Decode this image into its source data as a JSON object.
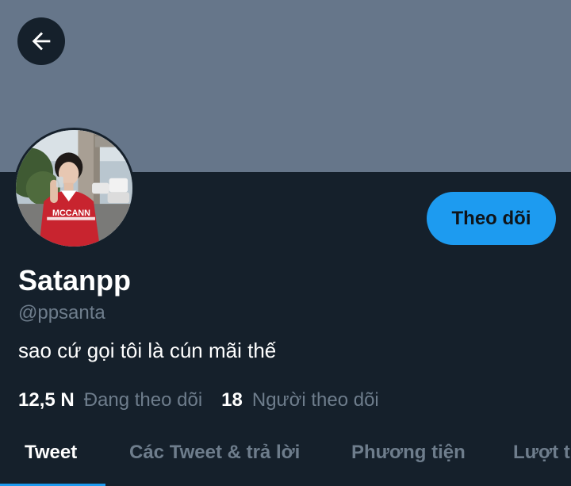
{
  "profile": {
    "display_name": "Satanpp",
    "handle": "@ppsanta",
    "bio": "sao cứ gọi tôi là cún mãi thế",
    "follow_label": "Theo dõi",
    "banner_color": "#66768a",
    "avatar_jersey_text": "MCCANN"
  },
  "stats": {
    "following_count": "12,5 N",
    "following_label": "Đang theo dõi",
    "followers_count": "18",
    "followers_label": "Người theo dõi"
  },
  "tabs": [
    {
      "label": "Tweet",
      "active": true
    },
    {
      "label": "Các Tweet & trả lời",
      "active": false
    },
    {
      "label": "Phương tiện",
      "active": false
    },
    {
      "label": "Lượt thích",
      "active": false
    }
  ],
  "colors": {
    "background": "#15202b",
    "accent": "#1d9bf0",
    "secondary_text": "#6e7d8c",
    "primary_text": "#ffffff"
  },
  "icons": {
    "back": "arrow-left-icon"
  }
}
